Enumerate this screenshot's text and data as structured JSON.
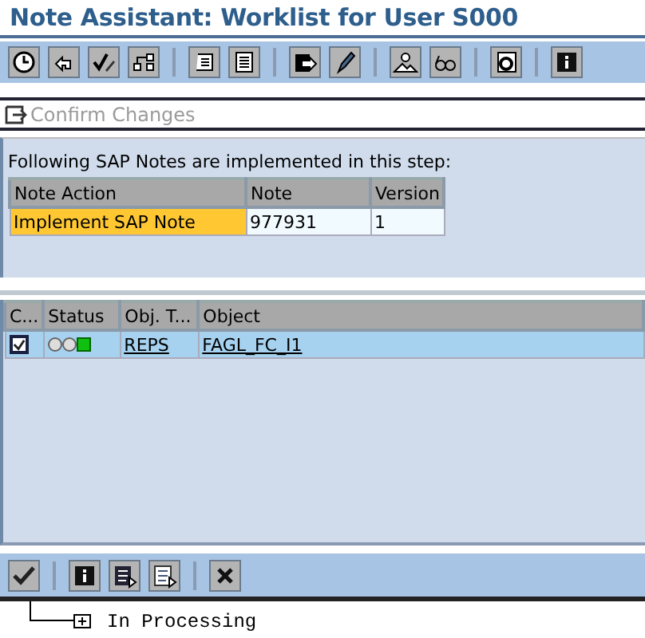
{
  "window": {
    "title": "Note Assistant: Worklist for User S000"
  },
  "confirm_bar": {
    "label": "Confirm Changes",
    "disabled": true
  },
  "notes_panel": {
    "caption": "Following SAP Notes are implemented in this step:",
    "columns": [
      "Note Action",
      "Note",
      "Version"
    ],
    "rows": [
      {
        "cells": [
          "Implement SAP Note",
          "977931",
          "1"
        ]
      }
    ]
  },
  "objects_table": {
    "columns": [
      "C...",
      "Status",
      "Obj. T...",
      "Object"
    ],
    "rows": [
      {
        "checked": true,
        "status_lights": [
          {
            "on": false
          },
          {
            "on": false
          },
          {
            "on": true
          }
        ],
        "object_type": "REPS",
        "object": "FAGL_FC_I1",
        "selected": true
      }
    ]
  },
  "tree": {
    "items": [
      {
        "label": "In Processing",
        "expanded": false
      }
    ]
  }
}
